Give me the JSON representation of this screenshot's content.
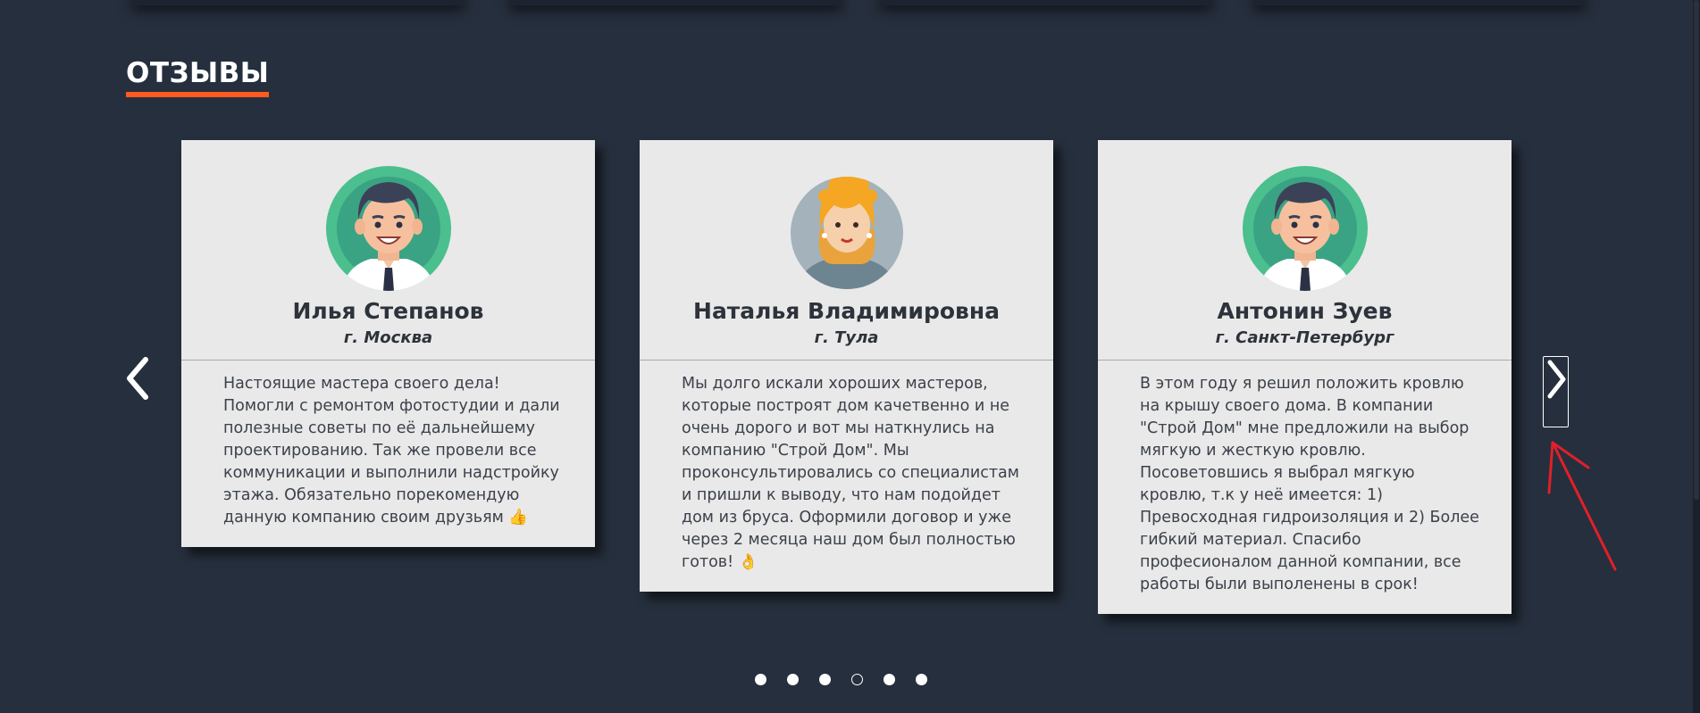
{
  "section": {
    "title": "ОТЗЫВЫ"
  },
  "reviews": [
    {
      "name": "Илья Степанов",
      "city": "г. Москва",
      "avatar": "man-avatar-icon",
      "text": "Настоящие мастера своего дела! Помогли с ремонтом фотостудии и дали полезные советы по её дальнейшему проектированию. Так же провели все коммуникации и выполнили надстройку этажа. Обязательно порекомендую данную компанию своим друзьям 👍"
    },
    {
      "name": "Наталья Владимировна",
      "city": "г. Тула",
      "avatar": "woman-avatar-icon",
      "text": "Мы долго искали хороших мастеров, которые построят дом качетвенно и не очень дорого и вот мы наткнулись на компанию \"Строй Дом\". Мы проконсультировались со специалистам и пришли к выводу, что нам подойдет дом из бруса. Оформили договор и уже через 2 месяца наш дом был полностью готов! 👌"
    },
    {
      "name": "Антонин Зуев",
      "city": "г. Санкт-Петербург",
      "avatar": "man-avatar-icon",
      "text": "В этом году я решил положить кровлю на крышу своего дома. В компании \"Строй Дом\" мне предложили на выбор мягкую и жесткую кровлю. Посоветовшись я выбрал мягкую кровлю, т.к у неё имеется: 1) Превосходная гидроизоляция и 2) Более гибкий материал. Спасибо професионалом данной компании, все работы были выполенены в срок!"
    }
  ],
  "carousel": {
    "prev_icon": "chevron-left-icon",
    "next_icon": "chevron-right-icon",
    "dots_total": 6,
    "active_dot": 4
  },
  "colors": {
    "background": "#262f3d",
    "accent": "#ff5a1f",
    "card": "#e9e9e9",
    "annotation": "#e0202a"
  }
}
